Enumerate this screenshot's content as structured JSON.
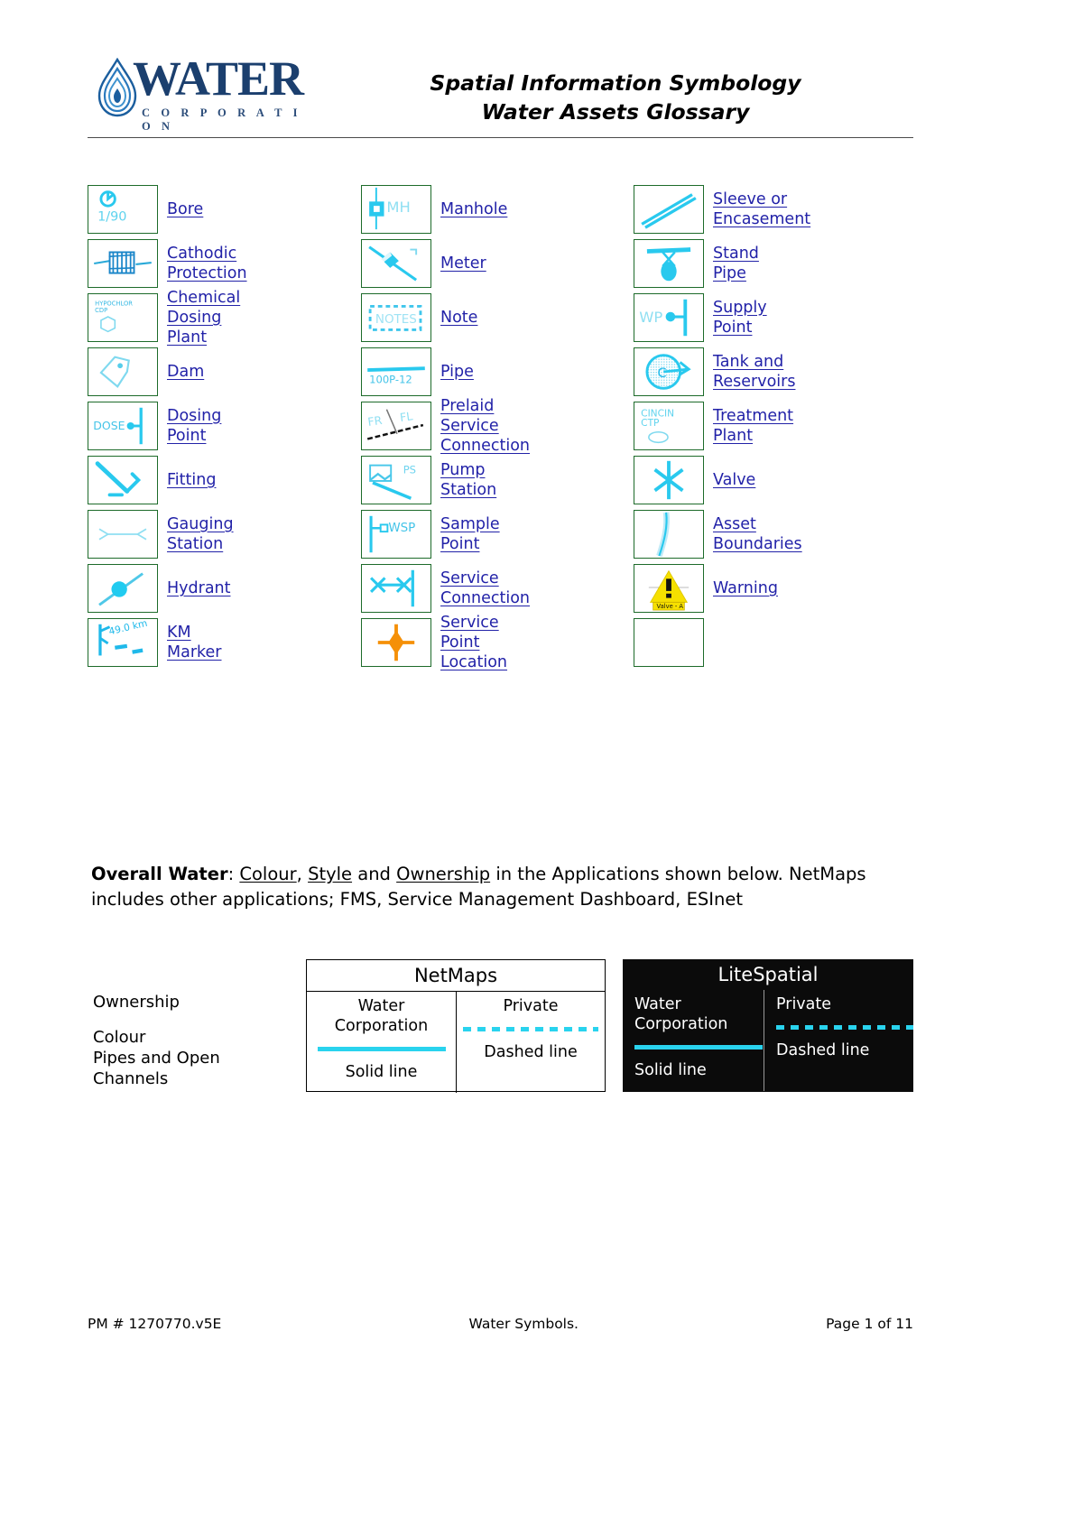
{
  "header": {
    "logo_word": "WATER",
    "logo_sub": "C O R P O R A T I O N",
    "title_line1": "Spatial Information Symbology",
    "title_line2": "Water Assets Glossary"
  },
  "symbols": {
    "column1": [
      {
        "label": "Bore",
        "icon": "bore-symbol",
        "icon_text": "1/90"
      },
      {
        "label": "Cathodic Protection",
        "icon": "cathodic-protection-symbol",
        "icon_text": ""
      },
      {
        "label": "Chemical Dosing Plant",
        "icon": "chemical-dosing-plant-symbol",
        "icon_text": "HYPOCHLOR CDP"
      },
      {
        "label": "Dam",
        "icon": "dam-symbol",
        "icon_text": ""
      },
      {
        "label": "Dosing Point",
        "icon": "dosing-point-symbol",
        "icon_text": "DOSE"
      },
      {
        "label": "Fitting",
        "icon": "fitting-symbol",
        "icon_text": ""
      },
      {
        "label": "Gauging Station",
        "icon": "gauging-station-symbol",
        "icon_text": ""
      },
      {
        "label": "Hydrant",
        "icon": "hydrant-symbol",
        "icon_text": ""
      },
      {
        "label": "KM Marker",
        "icon": "km-marker-symbol",
        "icon_text": "49.0 km"
      }
    ],
    "column2": [
      {
        "label": "Manhole",
        "icon": "manhole-symbol",
        "icon_text": "MH"
      },
      {
        "label": "Meter",
        "icon": "meter-symbol",
        "icon_text": ""
      },
      {
        "label": "Note",
        "icon": "note-symbol",
        "icon_text": "NOTES"
      },
      {
        "label": "Pipe",
        "icon": "pipe-symbol",
        "icon_text": "100P-12"
      },
      {
        "label": "Prelaid Service\nConnection",
        "icon": "prelaid-service-connection-symbol",
        "icon_text": "FR FL"
      },
      {
        "label": "Pump Station",
        "icon": "pump-station-symbol",
        "icon_text": "PS"
      },
      {
        "label": "Sample Point",
        "icon": "sample-point-symbol",
        "icon_text": "WSP"
      },
      {
        "label": "Service Connection",
        "icon": "service-connection-symbol",
        "icon_text": ""
      },
      {
        "label": "Service Point Location",
        "icon": "service-point-location-symbol",
        "icon_text": ""
      }
    ],
    "column3": [
      {
        "label": "Sleeve or Encasement",
        "icon": "sleeve-or-encasement-symbol",
        "icon_text": ""
      },
      {
        "label": "Stand Pipe",
        "icon": "stand-pipe-symbol",
        "icon_text": ""
      },
      {
        "label": "Supply Point",
        "icon": "supply-point-symbol",
        "icon_text": "WP"
      },
      {
        "label": "Tank and Reservoirs",
        "icon": "tank-and-reservoirs-symbol",
        "icon_text": ""
      },
      {
        "label": "Treatment Plant",
        "icon": "treatment-plant-symbol",
        "icon_text": "CINCIN CTP"
      },
      {
        "label": "Valve",
        "icon": "valve-symbol",
        "icon_text": ""
      },
      {
        "label": "Asset Boundaries",
        "icon": "asset-boundaries-symbol",
        "icon_text": ""
      },
      {
        "label": "Warning",
        "icon": "warning-symbol",
        "icon_text": "Valve - A"
      },
      {
        "label": "",
        "icon": "empty-symbol",
        "icon_text": ""
      }
    ]
  },
  "paragraph": {
    "lead_bold": "Overall Water",
    "after_bold": ": ",
    "u1": "Colour",
    "sep1": ", ",
    "u2": "Style",
    "sep2": " and ",
    "u3": "Ownership",
    "tail": " in the Applications shown below. NetMaps includes other applications; FMS, Service Management Dashboard, ESInet"
  },
  "comparison": {
    "row_labels": {
      "ownership": "Ownership",
      "colour": "Colour",
      "pipes": "Pipes and Open\nChannels"
    },
    "tables": [
      {
        "name": "NetMaps",
        "theme": "light",
        "columns": [
          {
            "owner": "Water\nCorporation",
            "line_style": "solid",
            "style_text": "Solid line"
          },
          {
            "owner": "Private",
            "line_style": "dashed",
            "style_text": "Dashed line"
          }
        ]
      },
      {
        "name": "LiteSpatial",
        "theme": "dark",
        "columns": [
          {
            "owner": "Water\nCorporation",
            "line_style": "solid",
            "style_text": "Solid line"
          },
          {
            "owner": "Private",
            "line_style": "dashed",
            "style_text": "Dashed line"
          }
        ]
      }
    ]
  },
  "footer": {
    "left": "PM # 1270770.v5E",
    "center": "Water Symbols.",
    "right": "Page 1 of 11"
  },
  "colors": {
    "cyan": "#29c9ee",
    "cyan_light": "#8fdff2",
    "green_border": "#1d6b2a",
    "link_blue": "#2222a8",
    "logo_blue": "#1b3f6e",
    "orange": "#f59008",
    "warning_yellow": "#f6e000"
  }
}
